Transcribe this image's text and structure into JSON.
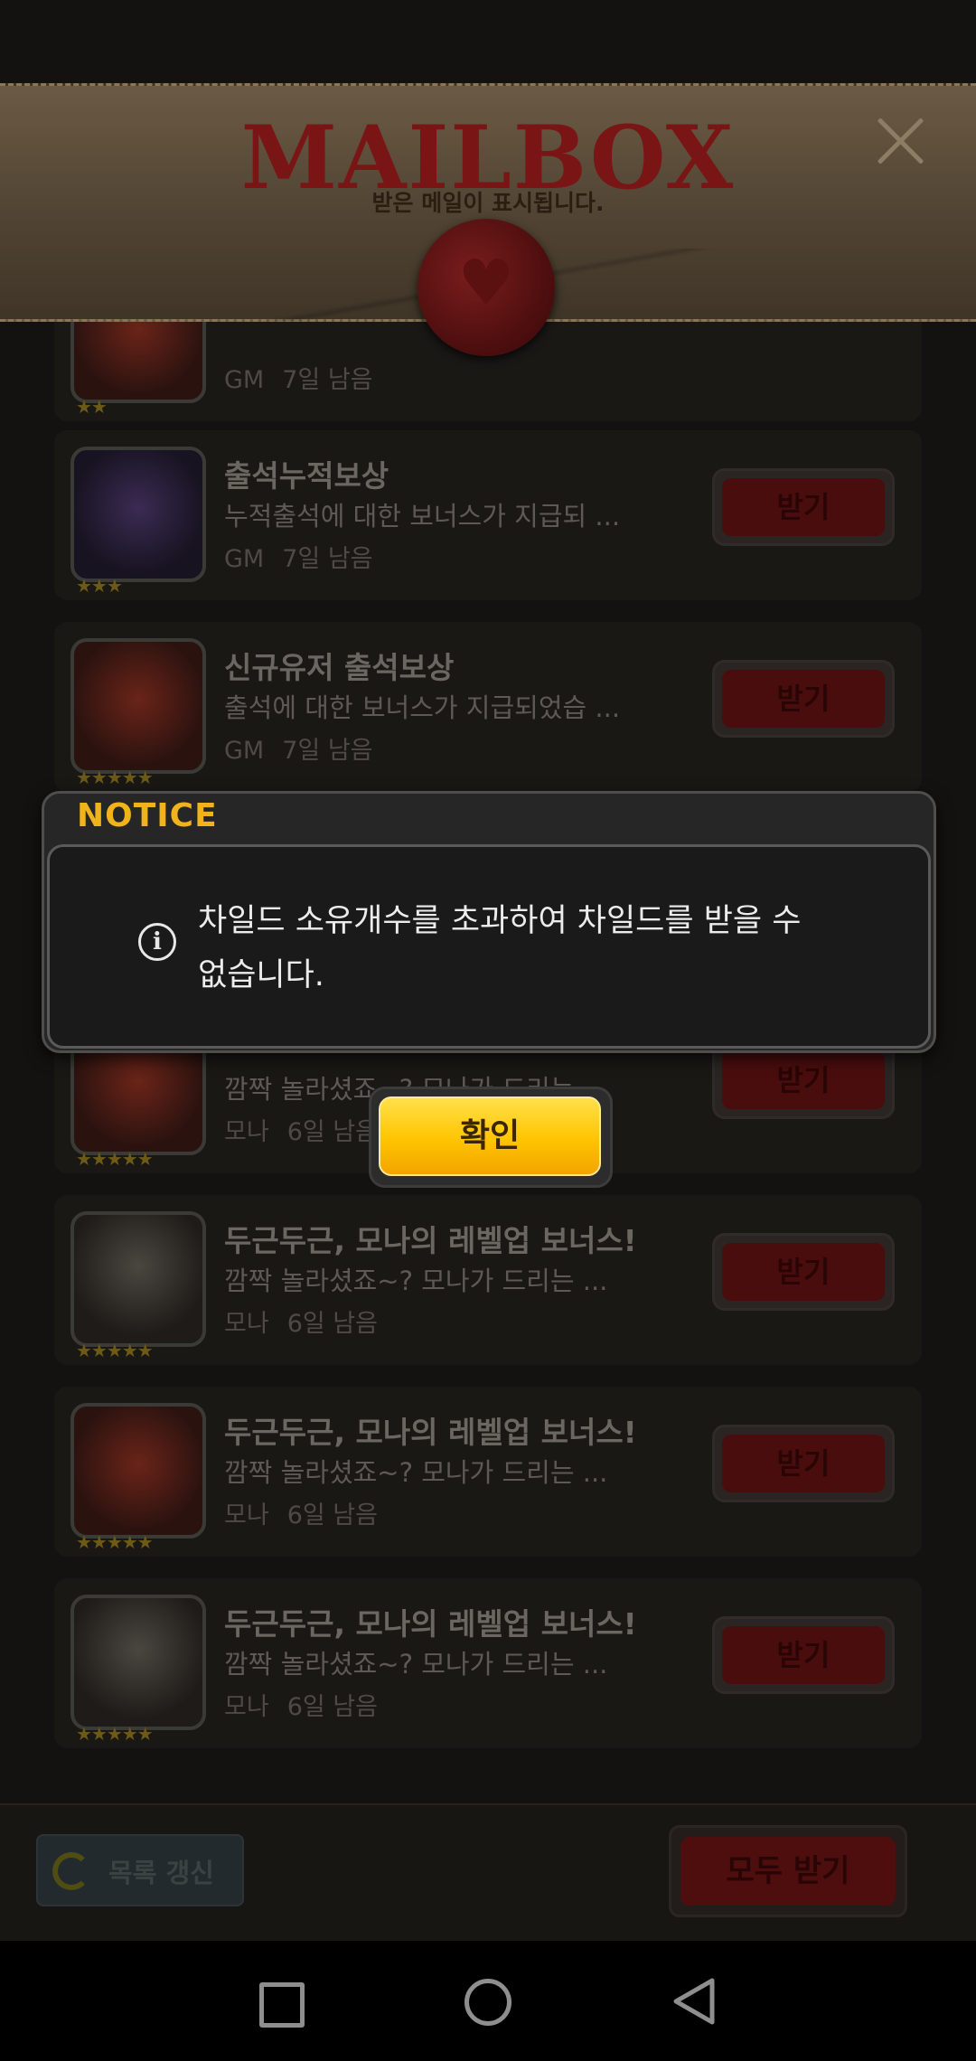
{
  "header": {
    "title": "MAILBOX",
    "subtitle": "받은 메일이 표시됩니다."
  },
  "mails": [
    {
      "title": "",
      "desc": "",
      "sender": "GM",
      "remain": "7일 남음",
      "button": "",
      "stars": "★★"
    },
    {
      "title": "출석누적보상",
      "desc": "누적출석에 대한 보너스가 지급되 ...",
      "sender": "GM",
      "remain": "7일 남음",
      "button": "받기",
      "stars": "★★★"
    },
    {
      "title": "신규유저 출석보상",
      "desc": "출석에 대한 보너스가 지급되었습 ...",
      "sender": "GM",
      "remain": "7일 남음",
      "button": "받기",
      "stars": "★★★★★"
    },
    {
      "title": "",
      "desc": "깜짝 놀라셨죠~? 모나가 드리는 ...",
      "sender": "모나",
      "remain": "6일 남음",
      "button": "받기",
      "stars": "★★★★★"
    },
    {
      "title": "두근두근, 모나의 레벨업 보너스!",
      "desc": "깜짝 놀라셨죠~? 모나가 드리는 ...",
      "sender": "모나",
      "remain": "6일 남음",
      "button": "받기",
      "stars": "★★★★★"
    },
    {
      "title": "두근두근, 모나의 레벨업 보너스!",
      "desc": "깜짝 놀라셨죠~? 모나가 드리는 ...",
      "sender": "모나",
      "remain": "6일 남음",
      "button": "받기",
      "stars": "★★★★★"
    },
    {
      "title": "두근두근, 모나의 레벨업 보너스!",
      "desc": "깜짝 놀라셨죠~? 모나가 드리는 ...",
      "sender": "모나",
      "remain": "6일 남음",
      "button": "받기",
      "stars": "★★★★★"
    }
  ],
  "bottom": {
    "refresh_label": "목록 갱신",
    "receive_all_label": "모두 받기"
  },
  "notice": {
    "title": "NOTICE",
    "message": "차일드 소유개수를 초과하여 차일드를 받을 수 없습니다.",
    "ok_label": "확인",
    "icon": "info-icon"
  },
  "navbar": {
    "icons": [
      "recent-apps-icon",
      "home-icon",
      "back-icon"
    ]
  }
}
